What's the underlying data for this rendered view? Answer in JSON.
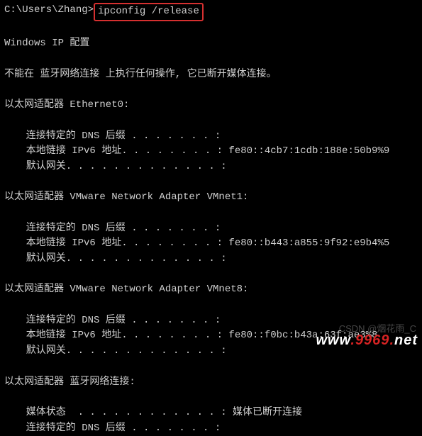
{
  "prompt": {
    "path": "C:\\Users\\Zhang>",
    "command": "ipconfig /release"
  },
  "header": "Windows IP 配置",
  "warning": "不能在 蓝牙网络连接 上执行任何操作, 它已断开媒体连接。",
  "adapters": [
    {
      "title": "以太网适配器 Ethernet0:",
      "rows": [
        {
          "label": "连接特定的 DNS 后缀 . . . . . . . :",
          "value": ""
        },
        {
          "label": "本地链接 IPv6 地址. . . . . . . . :",
          "value": "fe80::4cb7:1cdb:188e:50b9%9"
        },
        {
          "label": "默认网关. . . . . . . . . . . . . :",
          "value": ""
        }
      ]
    },
    {
      "title": "以太网适配器 VMware Network Adapter VMnet1:",
      "rows": [
        {
          "label": "连接特定的 DNS 后缀 . . . . . . . :",
          "value": ""
        },
        {
          "label": "本地链接 IPv6 地址. . . . . . . . :",
          "value": "fe80::b443:a855:9f92:e9b4%5"
        },
        {
          "label": "默认网关. . . . . . . . . . . . . :",
          "value": ""
        }
      ]
    },
    {
      "title": "以太网适配器 VMware Network Adapter VMnet8:",
      "rows": [
        {
          "label": "连接特定的 DNS 后缀 . . . . . . . :",
          "value": ""
        },
        {
          "label": "本地链接 IPv6 地址. . . . . . . . :",
          "value": "fe80::f0bc:b43a:63f:ae3%8"
        },
        {
          "label": "默认网关. . . . . . . . . . . . . :",
          "value": ""
        }
      ]
    },
    {
      "title": "以太网适配器 蓝牙网络连接:",
      "rows": [
        {
          "label": "媒体状态  . . . . . . . . . . . . :",
          "value": "媒体已断开连接"
        },
        {
          "label": "连接特定的 DNS 后缀 . . . . . . . :",
          "value": ""
        }
      ]
    }
  ],
  "watermarks": {
    "csdn": "CSDN @烟花雨_C",
    "site_w1": "www",
    "site_dot1": ".",
    "site_num": "9969",
    "site_dot2": ".",
    "site_net": "net"
  }
}
